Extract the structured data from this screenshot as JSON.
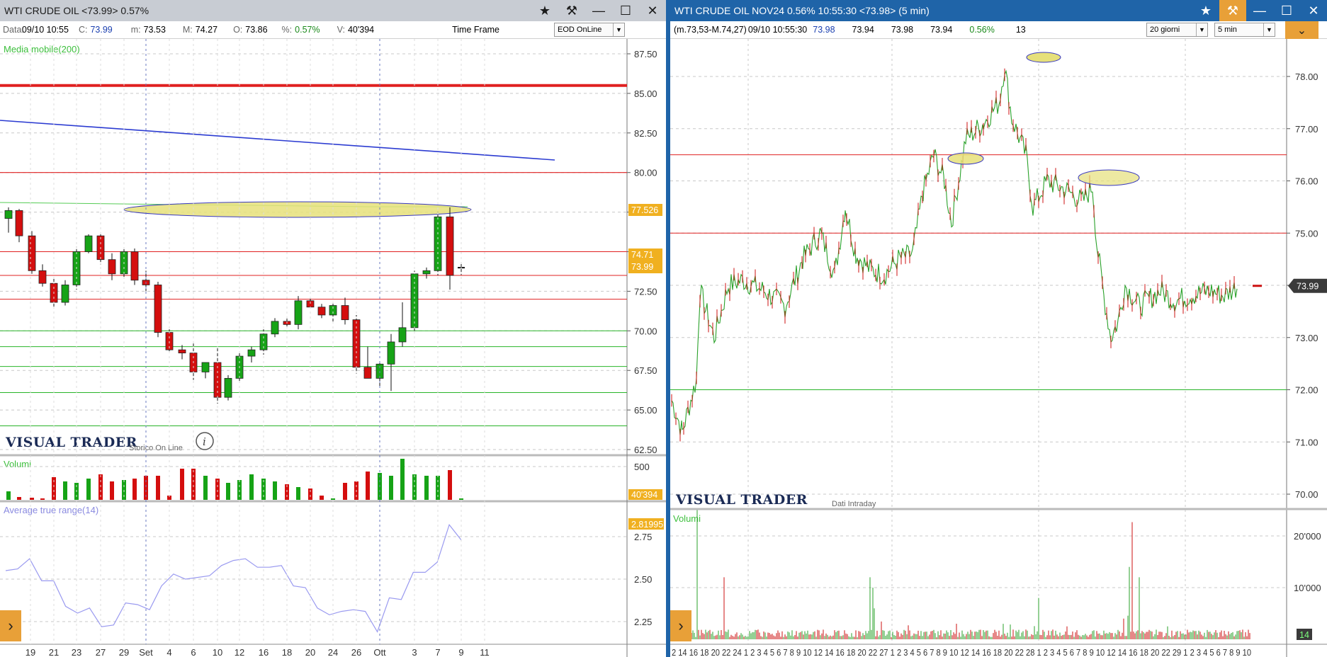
{
  "left": {
    "title": "WTI CRUDE OIL <73.99> 0.57%",
    "info": {
      "data_label": "Data:",
      "data_value": "09/10 10:55",
      "c_label": "C:",
      "c_value": "73.99",
      "m_label": "m:",
      "m_value": "73.53",
      "M_label": "M:",
      "M_value": "74.27",
      "o_label": "O:",
      "o_value": "73.86",
      "pct_label": "%:",
      "pct_value": "0.57%",
      "v_label": "V:",
      "v_value": "40'394",
      "timeframe_label": "Time Frame",
      "timeframe_select": "EOD OnLine"
    },
    "study_label": "Media mobile(200)",
    "brand": "VISUAL TRADER",
    "brand_sub": "Storico On Line",
    "volume_label": "Volumi",
    "atr_label": "Average true range(14)",
    "price_ticks": [
      "87.50",
      "85.00",
      "82.50",
      "80.00",
      "77.50",
      "75.00",
      "72.50",
      "70.00",
      "67.50",
      "65.00",
      "62.50"
    ],
    "price_badges": {
      "ma": "77.526",
      "high": "74.71",
      "last": "73.99"
    },
    "volume_tick": "500",
    "volume_badge": "40'394",
    "atr_ticks": [
      "2.75",
      "2.50",
      "2.25"
    ],
    "atr_badge": "2.81995",
    "x_ticks": [
      "19",
      "21",
      "23",
      "27",
      "29",
      "Set",
      "4",
      "6",
      "10",
      "12",
      "16",
      "18",
      "20",
      "24",
      "26",
      "Ott",
      "3",
      "7",
      "9",
      "11"
    ],
    "colors": {
      "up": "#16a316",
      "down": "#d40e0e",
      "trendline": "#2b3bd1",
      "support": "#28b428",
      "resistance": "#e02020",
      "badge": "#f0b020",
      "ellipse": "#e6e07a"
    }
  },
  "right": {
    "title": "WTI CRUDE OIL NOV24 0.56% 10:55:30 <73.98> (5 min)",
    "info": {
      "range": "(m.73,53-M.74,27)",
      "time": "09/10 10:55:30",
      "v1": "73.98",
      "v2": "73.94",
      "v3": "73.98",
      "v4": "73.94",
      "pct": "0.56%",
      "count": "13",
      "period_select": "20 giorni",
      "interval_select": "5 min"
    },
    "brand": "VISUAL TRADER",
    "brand_sub": "Dati Intraday",
    "volume_label": "Volumi",
    "price_ticks": [
      "78.00",
      "77.00",
      "76.00",
      "75.00",
      "74.00",
      "73.00",
      "72.00",
      "71.00",
      "70.00"
    ],
    "last_badge": "73.99",
    "volume_ticks": [
      "20'000",
      "10'000"
    ],
    "volume_badge": "14",
    "x_axis_text": "2 14 16 18 20 22 24 1 2 3 4 5 6 7 8 9 10 12 14 16 18 20 22 27 1 2 3 4 5 6 7 8 9 10 12 14 16 18 20 22 28 1 2 3 4 5 6 7 8 9 10 12 14 16 18 20 22 29 1 2 3 4 5 6 7 8 9 10"
  }
}
